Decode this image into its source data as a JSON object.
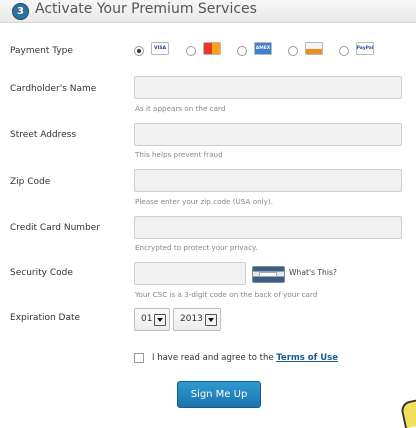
{
  "header": {
    "step": "3",
    "title": "Activate Your Premium Services"
  },
  "payment": {
    "label": "Payment Type",
    "selected": 0,
    "options": [
      {
        "icon": "visa-card-icon",
        "text": "VISA"
      },
      {
        "icon": "mastercard-icon",
        "text": ""
      },
      {
        "icon": "amex-card-icon",
        "text": "AMEX"
      },
      {
        "icon": "discover-card-icon",
        "text": ""
      },
      {
        "icon": "paypal-icon",
        "text": "PayPal"
      }
    ]
  },
  "fields": {
    "name": {
      "label": "Cardholder's Name",
      "hint": "As it appears on the card"
    },
    "street": {
      "label": "Street Address",
      "hint": "This helps prevent fraud"
    },
    "zip": {
      "label": "Zip Code",
      "hint": "Please enter your zip code (USA only)."
    },
    "card_number": {
      "label": "Credit Card Number",
      "hint": "Encrypted to protect your privacy."
    },
    "security": {
      "label": "Security Code",
      "whats_this": "What's This?",
      "hint": "Your CSC is a 3-digit code on the back of your card"
    },
    "expiration": {
      "label": "Expiration Date",
      "month": "01",
      "year": "2013"
    }
  },
  "terms": {
    "prefix": "I have read and agree to the ",
    "link": "Terms of Use"
  },
  "submit_label": "Sign Me Up",
  "colors": {
    "accent": "#2f6f98",
    "button": "#1b74ad"
  }
}
